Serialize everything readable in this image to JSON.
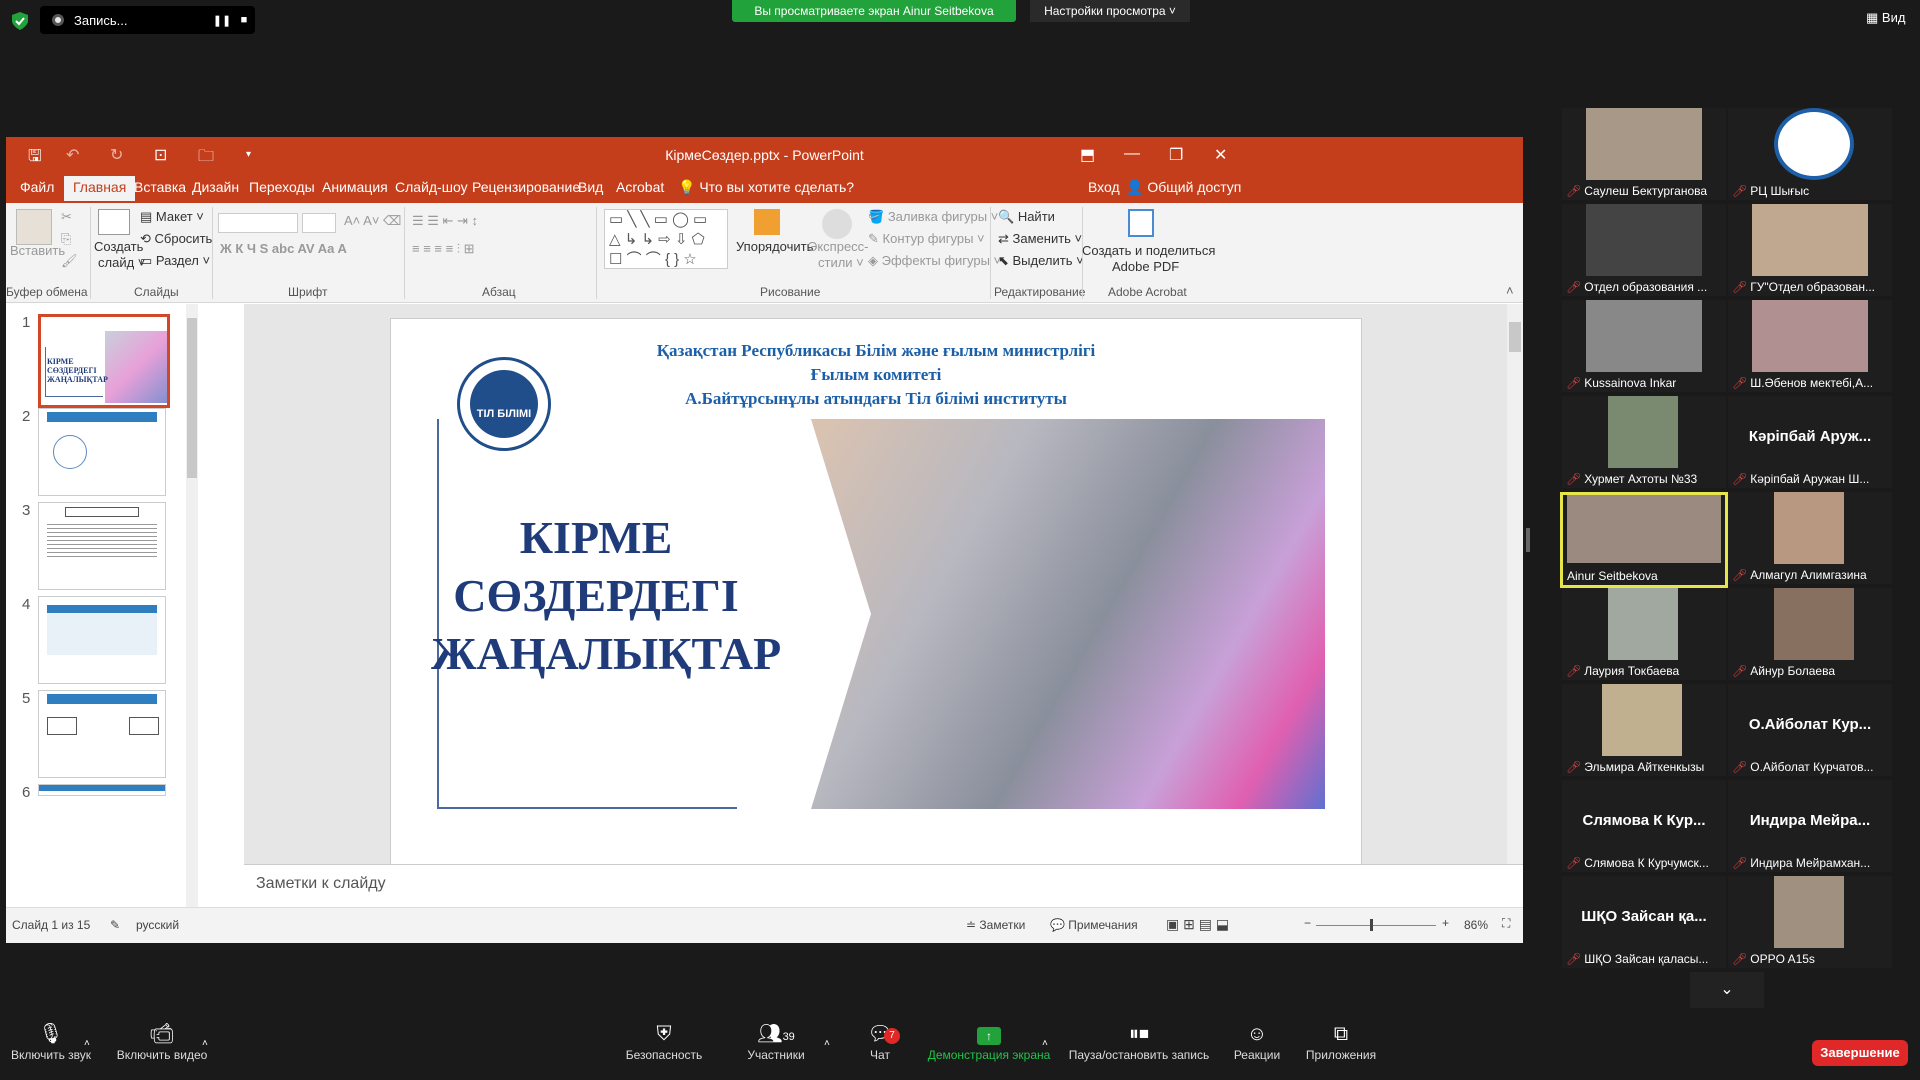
{
  "zoom_bar": {
    "recording_label": "Запись...",
    "viewing_banner": "Вы просматриваете экран Ainur Seitbekova",
    "view_settings": "Настройки просмотра ˅",
    "view_button": "Вид"
  },
  "ppt": {
    "window_title": "КірмеСөздер.pptx  -  PowerPoint",
    "menu": [
      "Файл",
      "Главная",
      "Вставка",
      "Дизайн",
      "Переходы",
      "Анимация",
      "Слайд-шоу",
      "Рецензирование",
      "Вид",
      "Acrobat"
    ],
    "tell_me": "Что вы хотите сделать?",
    "login": "Вход",
    "share": "Общий доступ",
    "ribbon": {
      "paste": "Вставить",
      "clipboard_group": "Буфер обмена",
      "new_slide_1": "Создать",
      "new_slide_2": "слайд ˅",
      "layout": "Макет ˅",
      "reset": "Сбросить",
      "section": "Раздел ˅",
      "slides_group": "Слайды",
      "font_group": "Шрифт",
      "paragraph_group": "Абзац",
      "arrange_1": "Упорядочить",
      "quick_styles_1": "Экспресс-",
      "quick_styles_2": "стили ˅",
      "shape_fill": "Заливка фигуры ˅",
      "shape_outline": "Контур фигуры ˅",
      "shape_effects": "Эффекты фигуры ˅",
      "drawing_group": "Рисование",
      "find": "Найти",
      "replace": "Заменить ˅",
      "select": "Выделить ˅",
      "editing_group": "Редактирование",
      "acrobat_1": "Создать и поделиться",
      "acrobat_2": "Adobe PDF",
      "acrobat_group": "Adobe Acrobat"
    },
    "thumbs": [
      "1",
      "2",
      "3",
      "4",
      "5",
      "6"
    ],
    "slide": {
      "header_1": "Қазақстан Республикасы Білім және ғылым министрлігі",
      "header_2": "Ғылым комитеті",
      "header_3": "А.Байтұрсынұлы атындағы Тіл білімі  институты",
      "title_1": "КІРМЕ",
      "title_2": "СӨЗДЕРДЕГІ",
      "title_3": "ЖАҢАЛЫҚТАР",
      "logo_text": "ТІЛ БІЛІМІ"
    },
    "notes_placeholder": "Заметки к слайду",
    "status": {
      "slide_of": "Слайд 1 из 15",
      "language": "русский",
      "notes": "Заметки",
      "comments": "Примечания",
      "zoom": "86%"
    }
  },
  "participants": [
    {
      "name": "Саулеш Бектурганова",
      "type": "photo"
    },
    {
      "name": "РЦ Шығыс",
      "type": "logo"
    },
    {
      "name": "Отдел образования ...",
      "type": "photo"
    },
    {
      "name": "ГУ\"Отдел образован...",
      "type": "photo"
    },
    {
      "name": "Kussainova Inkar",
      "type": "photo"
    },
    {
      "name": "Ш.Әбенов мектебі,А...",
      "type": "photo"
    },
    {
      "name": "Хурмет Ахтоты №33",
      "type": "photo"
    },
    {
      "name": "Кәріпбай Аружан Ш...",
      "type": "text",
      "big": "Кәріпбай  Аруж..."
    },
    {
      "name": "Ainur Seitbekova",
      "type": "photo",
      "active": true
    },
    {
      "name": "Алмагул Алимгазина",
      "type": "photo"
    },
    {
      "name": "Лаурия Токбаева",
      "type": "photo"
    },
    {
      "name": "Айнур Болаева",
      "type": "photo"
    },
    {
      "name": "Эльмира Айткенкызы",
      "type": "photo"
    },
    {
      "name": "О.Айболат Курчатов...",
      "type": "text",
      "big": "О.Айболат  Кур..."
    },
    {
      "name": "Слямова К Курчумск...",
      "type": "text",
      "big": "Слямова  К  Кур..."
    },
    {
      "name": "Индира Мейрамхан...",
      "type": "text",
      "big": "Индира  Мейра..."
    },
    {
      "name": "ШҚО Зайсан қаласы...",
      "type": "text",
      "big": "ШҚО  Зайсан  қа..."
    },
    {
      "name": "OPPO A15s",
      "type": "photo"
    }
  ],
  "bottom": {
    "mute": "Включить звук",
    "video": "Включить видео",
    "security": "Безопасность",
    "participants": "Участники",
    "participants_count": "39",
    "chat": "Чат",
    "chat_badge": "7",
    "share": "Демонстрация экрана",
    "record": "Пауза/остановить запись",
    "reactions": "Реакции",
    "apps": "Приложения",
    "end": "Завершение"
  },
  "colors": {
    "ppt_red": "#c43e1c",
    "zoom_green": "#22a23a",
    "slide_title_blue": "#1f3b7a",
    "header_blue": "#1b5fa8",
    "end_red": "#e02828"
  }
}
